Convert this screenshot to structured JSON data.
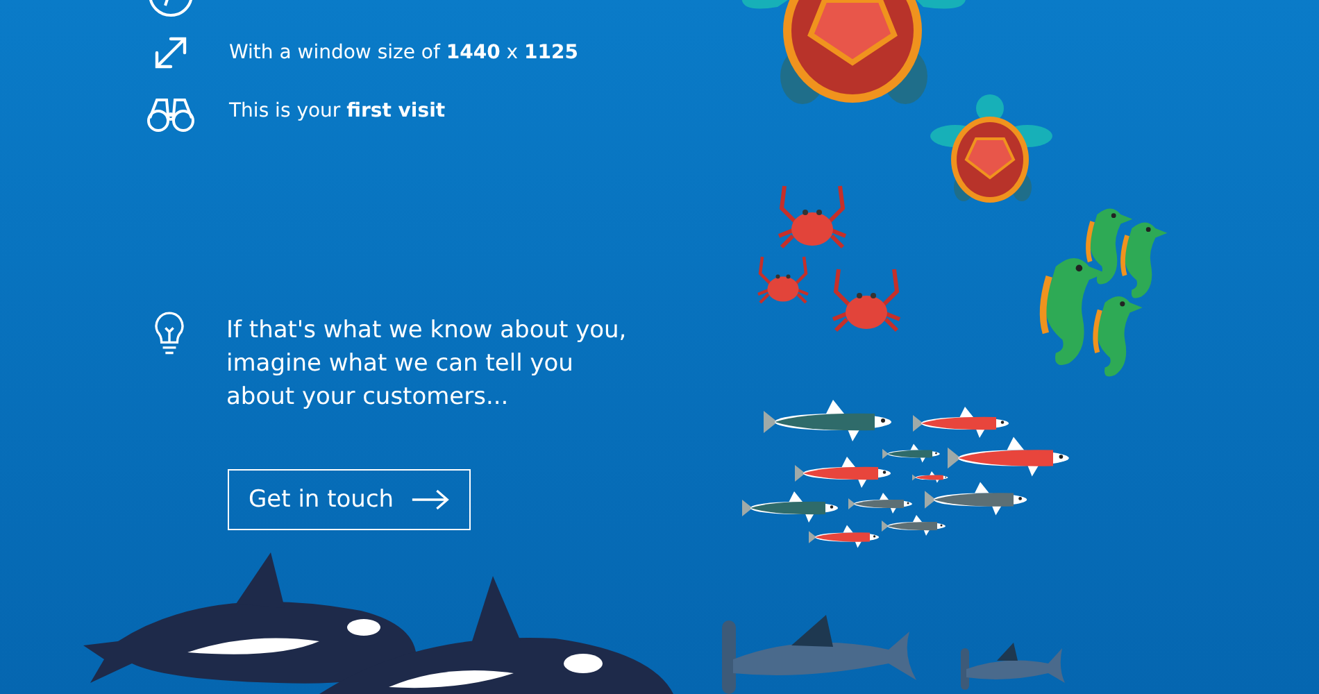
{
  "facts": [
    {
      "kind": "compass"
    },
    {
      "kind": "resize",
      "text": "With a window size of **1440** x **1125**"
    },
    {
      "kind": "binoculars",
      "text": "This is your **first visit**"
    }
  ],
  "message": {
    "kind": "lightbulb",
    "lines": [
      "If that's what we know about you,",
      "imagine what we can tell you",
      "about your customers..."
    ]
  },
  "cta": {
    "label": "Get in touch"
  }
}
